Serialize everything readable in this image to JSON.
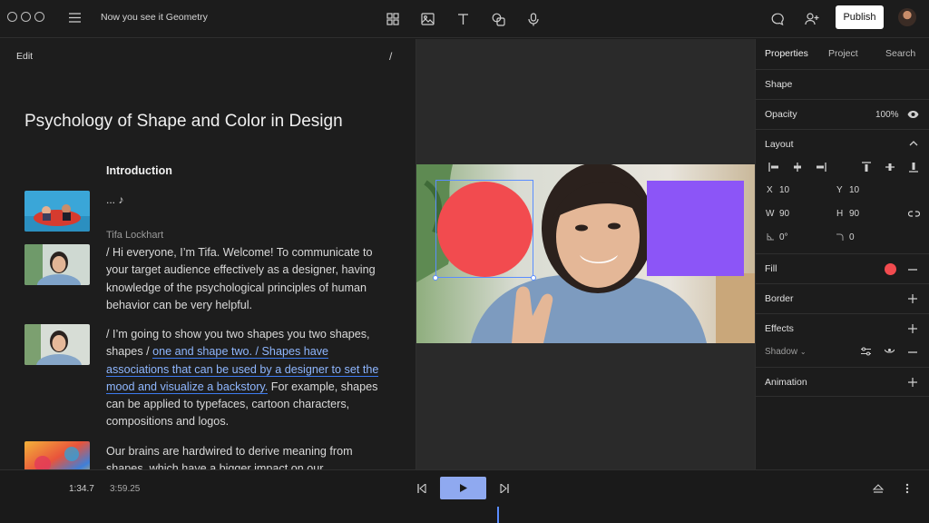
{
  "app": {
    "title": "Now you see it Geometry",
    "publish_label": "Publish"
  },
  "toolbar": {
    "icons": [
      "grid-icon",
      "image-icon",
      "text-icon",
      "shapes-icon",
      "microphone-icon"
    ],
    "right_icons": [
      "comment-icon",
      "add-user-icon"
    ]
  },
  "editor": {
    "edit_label": "Edit",
    "slash": "/",
    "heading": "Psychology of Shape and Color in Design",
    "section": "Introduction",
    "first_line": "... ♪",
    "speaker": "Tifa Lockhart",
    "para1": "/ Hi everyone, I’m Tifa. Welcome! To communicate to your target audience effectively as a designer, having knowledge of the psychological principles of human behavior can be very helpful.",
    "para2_before": "/ I’m going to show you two shapes you two shapes, shapes / ",
    "para2_highlight": "one and shape two. / Shapes have associations that can be used by a designer to set the mood and visualize a backstory.",
    "para2_after": " For example, shapes can be applied to typefaces, cartoon characters, compositions and logos.",
    "para3": "Our brains are hardwired to derive meaning from shapes, which have a bigger impact on our"
  },
  "properties": {
    "tabs": [
      "Properties",
      "Project",
      "Search"
    ],
    "shape_label": "Shape",
    "opacity_label": "Opacity",
    "opacity_value": "100%",
    "layout_label": "Layout",
    "x_label": "X",
    "x_value": "10",
    "y_label": "Y",
    "y_value": "10",
    "w_label": "W",
    "w_value": "90",
    "h_label": "H",
    "h_value": "90",
    "rotation_value": "0°",
    "radius_value": "0",
    "fill_label": "Fill",
    "fill_color": "#f24b4f",
    "border_label": "Border",
    "effects_label": "Effects",
    "shadow_label": "Shadow",
    "animation_label": "Animation"
  },
  "transport": {
    "current_time": "1:34.7",
    "total_time": "3:59.25"
  },
  "colors": {
    "accent": "#5a8dff",
    "play_button": "#8fa9f0",
    "red_shape": "#f24b4f",
    "purple_shape": "#8c55f7"
  }
}
